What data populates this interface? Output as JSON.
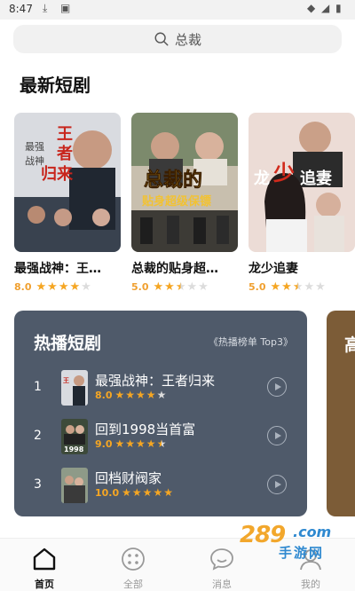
{
  "status_bar": {
    "time": "8:47"
  },
  "search": {
    "placeholder": "总裁"
  },
  "latest": {
    "title": "最新短剧",
    "items": [
      {
        "title": "最强战神：王者归来",
        "display_title": "最强战神：王…",
        "rating": "8.0",
        "stars": 4,
        "poster_text": "王者归来",
        "poster_sub": "最强战神"
      },
      {
        "title": "总裁的贴身超级保镖",
        "display_title": "总裁的贴身超…",
        "rating": "5.0",
        "stars": 2.5,
        "poster_text": "总裁的",
        "poster_sub": "贴身超级保镖"
      },
      {
        "title": "龙少追妻",
        "display_title": "龙少追妻",
        "rating": "5.0",
        "stars": 2.5,
        "poster_text": "龙少追妻",
        "poster_sub": ""
      }
    ]
  },
  "hot": {
    "title": "热播短剧",
    "rank_label": "《热播榜单 Top3》",
    "items": [
      {
        "rank": "1",
        "name": "最强战神：王者归来",
        "rating": "8.0",
        "stars": 4
      },
      {
        "rank": "2",
        "name": "回到1998当首富",
        "rating": "9.0",
        "stars": 4.5,
        "thumb_text": "1998"
      },
      {
        "rank": "3",
        "name": "回档财阀家",
        "rating": "10.0",
        "stars": 5
      }
    ]
  },
  "side_panel": {
    "title_char": "高"
  },
  "tabbar": {
    "items": [
      {
        "label": "首页",
        "icon": "home-icon",
        "active": true
      },
      {
        "label": "全部",
        "icon": "grid-icon",
        "active": false
      },
      {
        "label": "消息",
        "icon": "message-icon",
        "active": false
      },
      {
        "label": "我的",
        "icon": "profile-icon",
        "active": false
      }
    ]
  },
  "watermark": {
    "number": "289",
    "domain": ".com",
    "site": "手游网"
  },
  "colors": {
    "hot_panel": "#4f5a6a",
    "side_panel": "#7c5c37",
    "star": "#f5a623",
    "watermark_orange": "#f2a72c",
    "watermark_blue": "#2f89d0"
  }
}
